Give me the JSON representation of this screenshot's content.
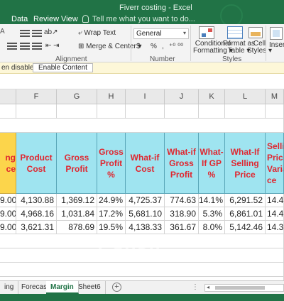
{
  "window": {
    "title": "Fiverr costing - Excel"
  },
  "ribbon_tabs": [
    "Data",
    "Review",
    "View"
  ],
  "tell_me": "Tell me what you want to do...",
  "ribbon": {
    "wrap_text": "Wrap Text",
    "merge_center": "Merge & Center",
    "number_format": "General",
    "currency": "$",
    "percent": "%",
    "comma": ",",
    "conditional": [
      "Conditional",
      "Formatting"
    ],
    "format_as": [
      "Format as",
      "Table"
    ],
    "cell": [
      "Cell",
      "Styles"
    ],
    "insert": "Insert",
    "group_alignment": "Alignment",
    "group_number": "Number",
    "group_styles": "Styles"
  },
  "infobar": {
    "message": "en disabled",
    "button": "Enable Content"
  },
  "columns": [
    "F",
    "G",
    "H",
    "I",
    "J",
    "K",
    "L",
    "M"
  ],
  "table": {
    "headers": {
      "e": "ng\nce",
      "f": "Product Cost",
      "g": "Gross Profit",
      "h": "Gross Profit %",
      "i": "What-if Cost",
      "j": "What-if Gross Profit",
      "k": "What-If GP %",
      "l": "What-If Selling Price",
      "m": "Sellin Pric Varia ce"
    },
    "rows": [
      {
        "e": "9.00",
        "f": "4,130.88",
        "g": "1,369.12",
        "h": "24.9%",
        "i": "4,725.37",
        "j": "774.63",
        "k": "14.1%",
        "l": "6,291.52",
        "m": "14.4"
      },
      {
        "e": "9.00",
        "f": "4,968.16",
        "g": "1,031.84",
        "h": "17.2%",
        "i": "5,681.10",
        "j": "318.90",
        "k": "5.3%",
        "l": "6,861.01",
        "m": "14.4"
      },
      {
        "e": "9.00",
        "f": "3,621.31",
        "g": "878.69",
        "h": "19.5%",
        "i": "4,138.33",
        "j": "361.67",
        "k": "8.0%",
        "l": "5,142.46",
        "m": "14.3"
      }
    ]
  },
  "sheet_tabs": [
    "ing",
    "Forecast",
    "Margin",
    "Sheet6"
  ],
  "active_sheet": "Margin",
  "add_sheet": "+",
  "watermark": "Capsh"
}
